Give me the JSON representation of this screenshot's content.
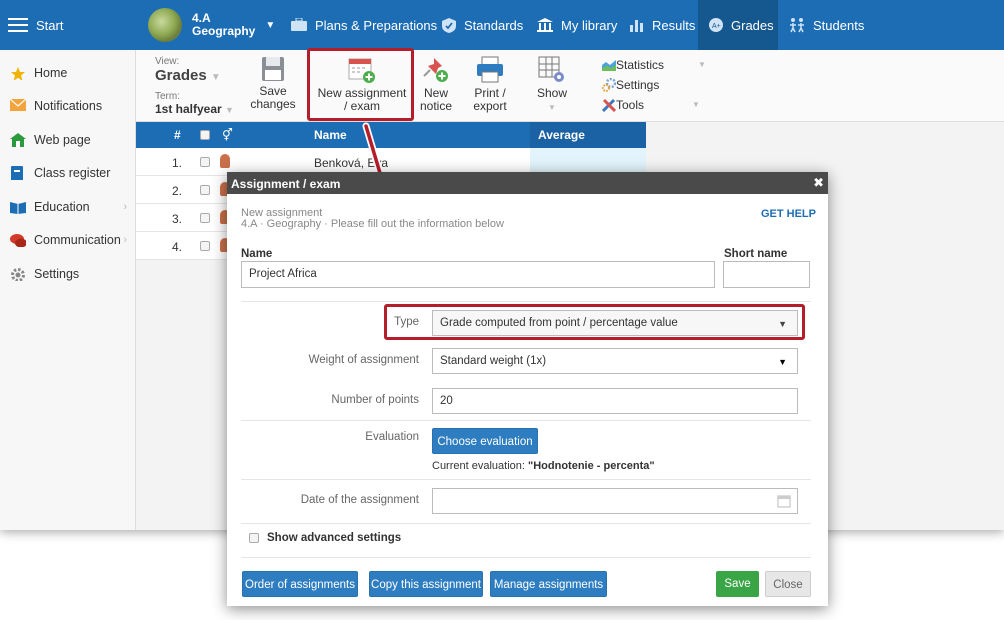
{
  "topnav": {
    "start_label": "Start",
    "class_line1": "4.A",
    "class_line2": "Geography",
    "items": [
      {
        "label": "Plans & Preparations",
        "icon": "briefcase-icon"
      },
      {
        "label": "Standards",
        "icon": "shield-check-icon"
      },
      {
        "label": "My library",
        "icon": "library-icon"
      },
      {
        "label": "Results",
        "icon": "bar-chart-icon"
      },
      {
        "label": "Grades",
        "icon": "grades-icon"
      },
      {
        "label": "Students",
        "icon": "students-icon"
      }
    ]
  },
  "sidebar": {
    "items": [
      {
        "label": "Home",
        "icon": "star-icon"
      },
      {
        "label": "Notifications",
        "icon": "envelope-icon"
      },
      {
        "label": "Web page",
        "icon": "house-icon"
      },
      {
        "label": "Class register",
        "icon": "book-icon"
      },
      {
        "label": "Education",
        "icon": "education-icon"
      },
      {
        "label": "Communication",
        "icon": "chat-icon"
      },
      {
        "label": "Settings",
        "icon": "gear-icon"
      }
    ]
  },
  "toolbar": {
    "view_label": "View:",
    "view_value": "Grades",
    "term_label": "Term:",
    "term_value": "1st halfyear",
    "save_line1": "Save",
    "save_line2": "changes",
    "new_assign_line1": "New assignment",
    "new_assign_line2": "/ exam",
    "new_notice_line1": "New",
    "new_notice_line2": "notice",
    "print_line1": "Print /",
    "print_line2": "export",
    "show_label": "Show",
    "statistics_label": "Statistics",
    "settings_label": "Settings",
    "tools_label": "Tools"
  },
  "grade_table": {
    "headers": {
      "num": "#",
      "name": "Name",
      "average": "Average"
    },
    "rows": [
      {
        "num": "1.",
        "name": "Benková, Eva"
      },
      {
        "num": "2.",
        "name": ""
      },
      {
        "num": "3.",
        "name": ""
      },
      {
        "num": "4.",
        "name": ""
      }
    ]
  },
  "modal": {
    "title": "Assignment / exam",
    "subtitle": "New assignment",
    "context": "4.A · Geography · Please fill out the information below",
    "get_help": "GET HELP",
    "name_label": "Name",
    "name_value": "Project Africa",
    "short_name_label": "Short name",
    "short_name_value": "",
    "type_label": "Type",
    "type_value": "Grade computed from point / percentage value",
    "weight_label": "Weight of assignment",
    "weight_value": "Standard weight (1x)",
    "points_label": "Number of points",
    "points_value": "20",
    "evaluation_label": "Evaluation",
    "choose_evaluation": "Choose evaluation",
    "current_eval_prefix": "Current evaluation:",
    "current_eval_value": "\"Hodnotenie - percenta\"",
    "date_label": "Date of the assignment",
    "date_value": "",
    "advanced_label": "Show advanced settings",
    "btn_order": "Order of assignments",
    "btn_copy": "Copy this assignment",
    "btn_manage": "Manage assignments",
    "btn_save": "Save",
    "btn_close": "Close"
  },
  "colors": {
    "nav_blue": "#1d6db5",
    "highlight_red": "#b31e2a",
    "save_green": "#3aa546",
    "modal_header": "#4a4a4a"
  }
}
